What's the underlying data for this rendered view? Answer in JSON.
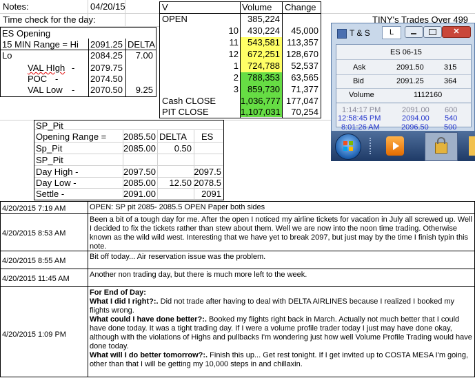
{
  "notes": {
    "label": "Notes:",
    "date": "04/20/15",
    "time_check": "Time check for the day:",
    "tiny_title": "TINY's Trades Over 499"
  },
  "es_opening": {
    "title": "ES Opening",
    "range_label": "15 MIN Range = Hi",
    "range_hi": "2091.25",
    "delta_label": "DELTA",
    "lo_label": "Lo",
    "lo_value": "2084.25",
    "delta_value": "7.00",
    "rows": [
      {
        "label": "VAL HIgh",
        "dash": "-",
        "value": "2079.75",
        "extra": ""
      },
      {
        "label": "POC",
        "dash": "-",
        "value": "2074.50",
        "extra": ""
      },
      {
        "label": "VAL Low",
        "dash": "-",
        "value": "2070.50",
        "extra": "9.25"
      }
    ]
  },
  "volume_table": {
    "headers": [
      "V",
      "Volume",
      "Change"
    ],
    "open_label": "OPEN",
    "open_volume": "385,224",
    "rows": [
      {
        "label": "10",
        "volume": "430,224",
        "change": "45,000",
        "fill": ""
      },
      {
        "label": "11",
        "volume": "543,581",
        "change": "113,357",
        "fill": "#ffff66"
      },
      {
        "label": "12",
        "volume": "672,251",
        "change": "128,670",
        "fill": "#ffff66"
      },
      {
        "label": "1",
        "volume": "724,788",
        "change": "52,537",
        "fill": "#ffff66"
      },
      {
        "label": "2",
        "volume": "788,353",
        "change": "63,565",
        "fill": "#66dd44"
      },
      {
        "label": "3",
        "volume": "859,730",
        "change": "71,377",
        "fill": "#66dd44"
      }
    ],
    "cash_close_label": "Cash CLOSE",
    "cash_close_volume": "1,036,777",
    "cash_close_change": "177,047",
    "pit_close_label": "PIT CLOSE",
    "pit_close_volume": "1,107,031",
    "pit_close_change": "70,254"
  },
  "ts_window": {
    "title": "T & S",
    "symbol": "ES 06-15",
    "ask_label": "Ask",
    "ask_price": "2091.50",
    "ask_size": "315",
    "bid_label": "Bid",
    "bid_price": "2091.25",
    "bid_size": "364",
    "volume_label": "Volume",
    "volume_value": "1112160",
    "trades": [
      {
        "time": "1:14:17 PM",
        "price": "2091.00",
        "size": "600",
        "color": "#8a8a9a"
      },
      {
        "time": "12:58:45 PM",
        "price": "2094.00",
        "size": "540",
        "color": "#2233cc"
      },
      {
        "time": "8:01:26 AM",
        "price": "2096.50",
        "size": "500",
        "color": "#2233cc"
      }
    ]
  },
  "sp_pit": {
    "title": "SP_Pit",
    "opening_label": "Opening Range =",
    "opening_value": "2085.50",
    "delta_label": "DELTA",
    "es_label": "ES",
    "sp_pit_label": "Sp_Pit",
    "sp_pit_value": "2085.00",
    "sp_pit_delta": "0.50",
    "title2": "SP_Pit",
    "day_high_label": "Day High -",
    "day_high_value": "2097.50",
    "day_high_es": "2097.5",
    "day_low_label": "Day Low -",
    "day_low_value": "2085.00",
    "day_low_delta": "12.50",
    "day_low_es": "2078.5",
    "settle_label": "Settle -",
    "settle_value": "2091.00",
    "settle_es": "2091"
  },
  "log": [
    {
      "time": "4/20/2015 7:19 AM",
      "text": "OPEN: SP pit 2085- 2085.5 OPEN  Paper both sides"
    },
    {
      "time": "4/20/2015 8:53 AM",
      "text": "Been a bit of a tough day for me.  After the open I noticed my airline tickets for vacation in July all screwed up.  Well I decided to fix the tickets rather than stew about them.  Well we are now into the noon time trading.  Otherwise known as the wild wild west.  Interesting that we have yet to break 2097, but just may by the time I finish typin this note."
    },
    {
      "time": "4/20/2015 8:55 AM",
      "text": "Bit off today...  Air reservation issue was the problem."
    },
    {
      "time": "4/20/2015 11:45 AM",
      "text": "Another non trading day, but there is much more left to the week."
    },
    {
      "time": "4/20/2015 1:09 PM",
      "eod_title": "For End of Day:",
      "q1": "What I did I right?:.",
      "a1": "  Did not trade after having to deal with DELTA AIRLINES because I realized I booked my flights wrong.",
      "q2": "What could I have done better?:.",
      "a2": "  Booked my flights right back in March.  Actually not much better that I could have done today.  It was a tight trading day.  If I were a volume profile trader today I just may have done okay, although with the violations of Highs and pullbacks I'm wondering just how well Volume Profile Trading would have done today.",
      "q3": "What will I do better tomorrow?:.",
      "a3": "  Finish this up... Get rest tonight.  If I get invited up to COSTA MESA I'm going, other than that I will be getting my 10,000 steps in and chillaxin."
    }
  ]
}
